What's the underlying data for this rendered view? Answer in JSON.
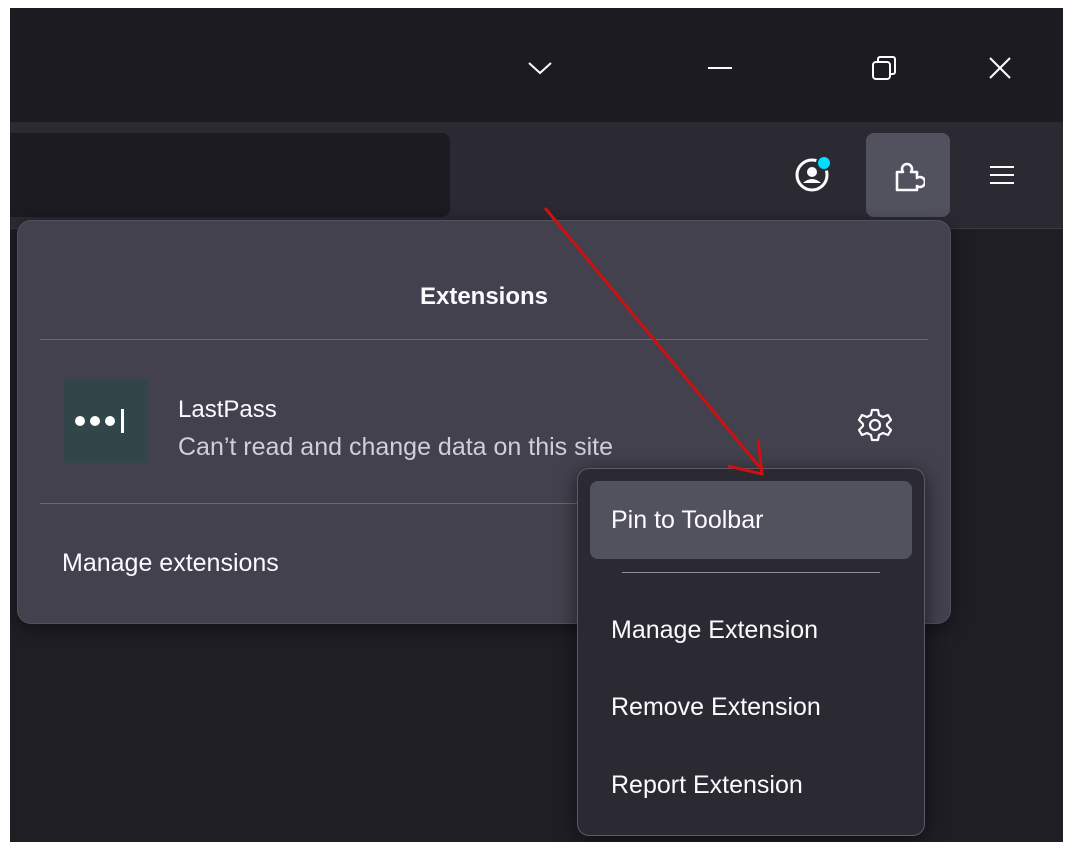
{
  "titlebar": {
    "icons": [
      "chevron-down-icon",
      "minimize-icon",
      "restore-icon",
      "close-icon"
    ]
  },
  "toolbar": {
    "icons": [
      "account-icon",
      "extensions-icon",
      "menu-icon"
    ],
    "account_badge_color": "#00ddff"
  },
  "panel": {
    "title": "Extensions",
    "extension": {
      "name": "LastPass",
      "description": "Can’t read and change data on this site",
      "icon": "lastpass-logo-icon",
      "settings_icon": "gear-icon"
    },
    "manage_label": "Manage extensions"
  },
  "context_menu": {
    "items": [
      {
        "label": "Pin to Toolbar"
      },
      {
        "label": "Manage Extension"
      },
      {
        "label": "Remove Extension"
      },
      {
        "label": "Report Extension"
      }
    ]
  },
  "colors": {
    "annotation_arrow": "#cc1111",
    "panel_bg": "#42414d",
    "menu_bg": "#2b2a33",
    "hover_bg": "#52525e"
  }
}
